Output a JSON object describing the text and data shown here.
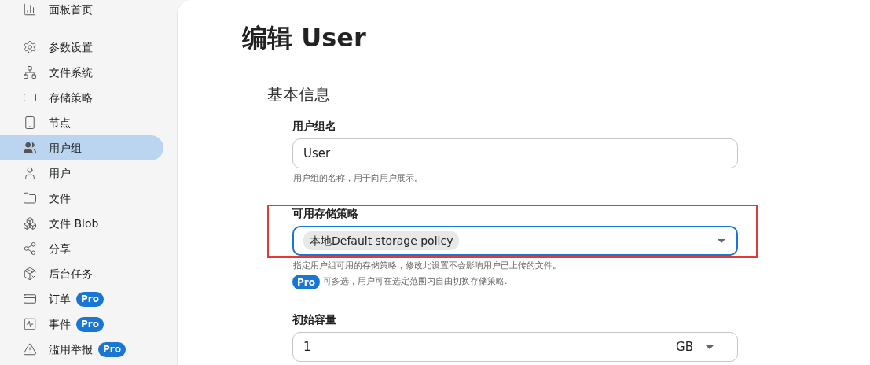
{
  "sidebar": {
    "groups": [
      {
        "items": [
          {
            "label": "面板首页",
            "selected": false
          }
        ]
      },
      {
        "items": [
          {
            "label": "参数设置",
            "selected": false
          },
          {
            "label": "文件系统",
            "selected": false
          },
          {
            "label": "存储策略",
            "selected": false
          },
          {
            "label": "节点",
            "selected": false
          },
          {
            "label": "用户组",
            "selected": true
          },
          {
            "label": "用户",
            "selected": false
          },
          {
            "label": "文件",
            "selected": false
          },
          {
            "label": "文件 Blob",
            "selected": false
          },
          {
            "label": "分享",
            "selected": false
          },
          {
            "label": "后台任务",
            "selected": false
          },
          {
            "label": "订单",
            "selected": false,
            "badge": "Pro"
          },
          {
            "label": "事件",
            "selected": false,
            "badge": "Pro"
          },
          {
            "label": "滥用举报",
            "selected": false,
            "badge": "Pro"
          }
        ]
      }
    ]
  },
  "page": {
    "title": "编辑 User",
    "section": "基本信息",
    "fields": [
      {
        "kind": "text",
        "label": "用户组名",
        "value": "User",
        "helper": "用户组的名称，用于向用户展示。"
      },
      {
        "kind": "chips",
        "label": "可用存储策略",
        "chips": [
          "本地Default storage policy"
        ],
        "focused": true,
        "highlighted": true,
        "helper": "指定用户组可用的存储策略，修改此设置不会影响用户已上传的文件。",
        "pro_badge": "Pro",
        "pro_note": "可多选，用户可在选定范围内自由切换存储策略."
      },
      {
        "kind": "size",
        "label": "初始容量",
        "value": "1",
        "unit": "GB"
      }
    ]
  }
}
